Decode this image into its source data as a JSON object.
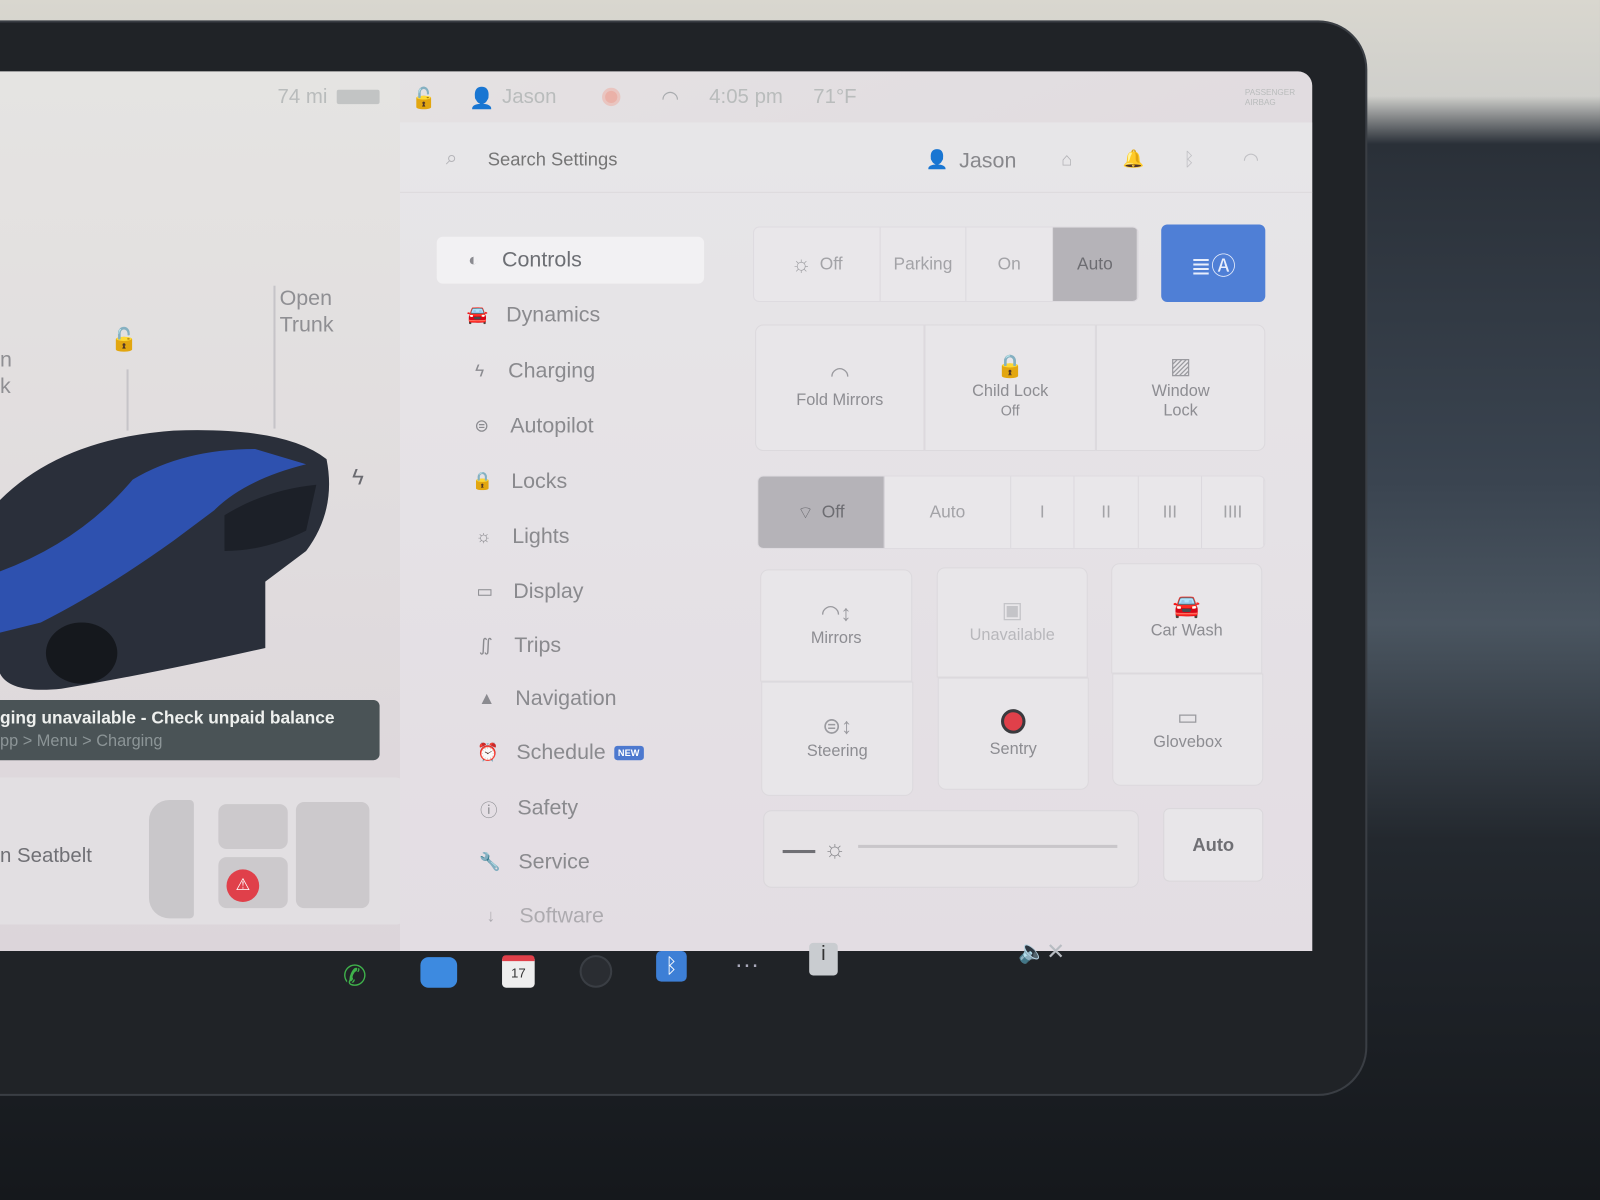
{
  "status_bar": {
    "range": "74 mi",
    "driver": "Jason",
    "time": "4:05 pm",
    "temperature": "71°F",
    "airbag_line1": "PASSENGER",
    "airbag_line2": "AIRBAG",
    "icons": [
      "battery-icon",
      "lock-icon",
      "user-icon",
      "sentry-icon",
      "wifi-icon",
      "airbag-icon"
    ]
  },
  "header": {
    "search_placeholder": "Search Settings",
    "profile": "Jason",
    "icons": [
      "search-icon",
      "user-icon",
      "home-icon",
      "bell-icon",
      "bluetooth-icon",
      "wifi-icon"
    ]
  },
  "car_panel": {
    "open_frunk_partial_1": "n",
    "open_frunk_partial_2": "k",
    "open_trunk_1": "Open",
    "open_trunk_2": "Trunk",
    "car_color": "#2f57c4"
  },
  "notification": {
    "line1": "ging unavailable - Check unpaid balance",
    "line2": "pp > Menu > Charging"
  },
  "seatbelt_card": {
    "label": "n Seatbelt",
    "alert_color": "#e0404a"
  },
  "sidebar": {
    "items": [
      {
        "label": "Controls",
        "icon": "toggle-icon",
        "selected": true
      },
      {
        "label": "Dynamics",
        "icon": "car-icon"
      },
      {
        "label": "Charging",
        "icon": "bolt-icon"
      },
      {
        "label": "Autopilot",
        "icon": "steering-wheel-icon"
      },
      {
        "label": "Locks",
        "icon": "lock-icon"
      },
      {
        "label": "Lights",
        "icon": "sun-icon"
      },
      {
        "label": "Display",
        "icon": "display-icon"
      },
      {
        "label": "Trips",
        "icon": "trips-icon"
      },
      {
        "label": "Navigation",
        "icon": "navigation-icon"
      },
      {
        "label": "Schedule",
        "icon": "alarm-icon",
        "badge": "NEW"
      },
      {
        "label": "Safety",
        "icon": "alert-icon"
      },
      {
        "label": "Service",
        "icon": "wrench-icon"
      },
      {
        "label": "Software",
        "icon": "download-icon"
      }
    ]
  },
  "lights": {
    "options": [
      "Off",
      "Parking",
      "On",
      "Auto"
    ],
    "selected": "Auto",
    "auto_high_beam_color": "#4f7fd6"
  },
  "row_tiles": [
    {
      "label": "Fold Mirrors"
    },
    {
      "label": "Child Lock",
      "sub": "Off"
    },
    {
      "label": "Window",
      "sub": "Lock"
    }
  ],
  "wipers": {
    "options": [
      "Off",
      "Auto",
      "I",
      "II",
      "III",
      "IIII"
    ],
    "selected": "Off"
  },
  "grid_tiles": [
    {
      "label": "Mirrors"
    },
    {
      "label": "Unavailable"
    },
    {
      "label": "Car Wash"
    },
    {
      "label": "Steering"
    },
    {
      "label": "Sentry"
    },
    {
      "label": "Glovebox"
    }
  ],
  "brightness": {
    "auto_label": "Auto",
    "level": 0
  },
  "dock": {
    "calendar_day": "17",
    "icons": [
      "phone-icon",
      "messages-icon",
      "calendar-icon",
      "camera-icon",
      "bluetooth-icon",
      "more-icon",
      "toybox-icon",
      "volume-mute-icon"
    ]
  }
}
